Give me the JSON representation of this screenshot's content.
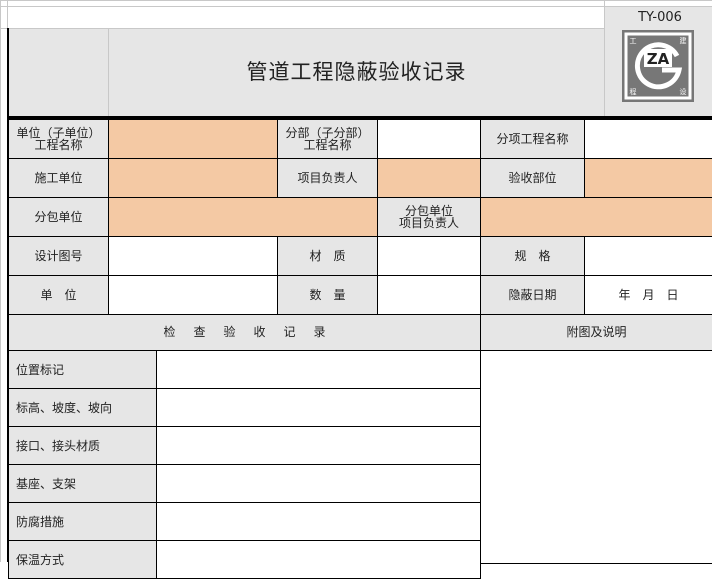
{
  "form": {
    "code": "TY-006",
    "title": "管道工程隐蔽验收记录",
    "logo": {
      "text": "ZA",
      "chars": [
        "工",
        "建",
        "程",
        "设"
      ]
    }
  },
  "info": {
    "unit_project_line1": "单位（子单位）",
    "unit_project_line2": "工程名称",
    "sub_project_line1": "分部（子分部）",
    "sub_project_line2": "工程名称",
    "item_project": "分项工程名称",
    "construction_unit": "施工单位",
    "project_manager": "项目负责人",
    "acceptance_part": "验收部位",
    "subcontract_unit": "分包单位",
    "subcontract_manager_line1": "分包单位",
    "subcontract_manager_line2": "项目负责人",
    "drawing_no": "设计图号",
    "material": "材　质",
    "spec": "规　格",
    "unit": "单　位",
    "quantity": "数　量",
    "concealed_date": "隐蔽日期",
    "date_placeholder": "年　月　日"
  },
  "check": {
    "header": "检查验收记录",
    "attach_header": "附图及说明",
    "items": [
      "位置标记",
      "标高、坡度、坡向",
      "接口、接头材质",
      "基座、支架",
      "防腐措施",
      "保温方式"
    ]
  }
}
